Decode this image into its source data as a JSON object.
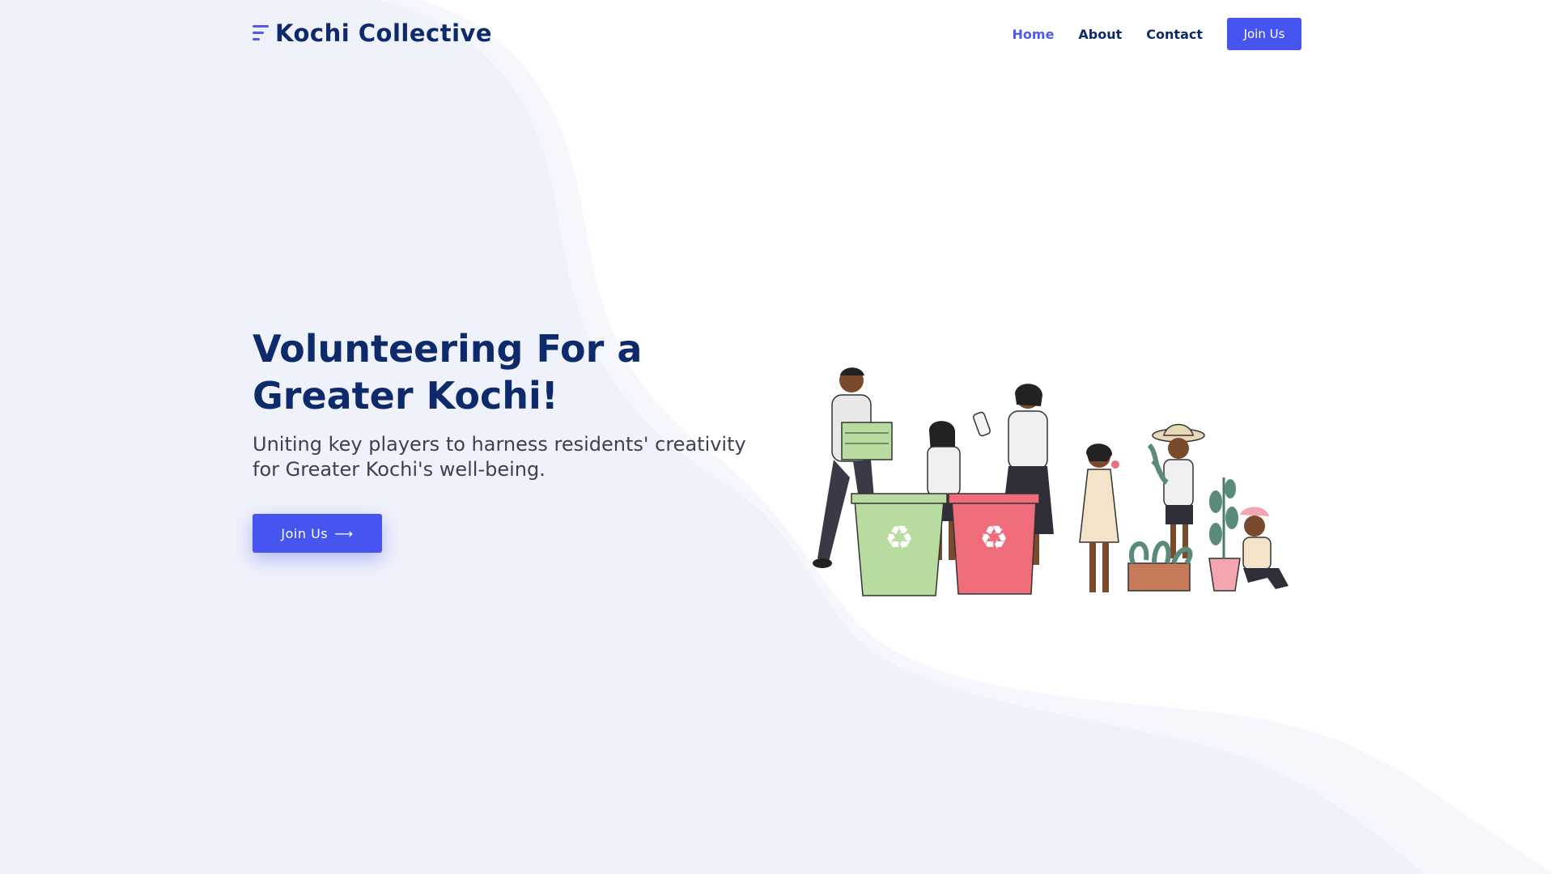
{
  "brand": {
    "name": "Kochi Collective",
    "accent_color": "#4655ef",
    "text_color": "#0d2a6b"
  },
  "nav": {
    "items": [
      {
        "label": "Home",
        "active": true
      },
      {
        "label": "About",
        "active": false
      },
      {
        "label": "Contact",
        "active": false
      }
    ],
    "cta_label": "Join Us"
  },
  "hero": {
    "title": "Volunteering For a Greater Kochi!",
    "subtitle": "Uniting key players to harness residents' creativity for Greater Kochi's well-being.",
    "cta_label": "Join Us",
    "cta_icon": "arrow-right-icon",
    "illustration": {
      "bin_left_color": "#b8dca0",
      "bin_right_color": "#ef6d7a"
    }
  }
}
